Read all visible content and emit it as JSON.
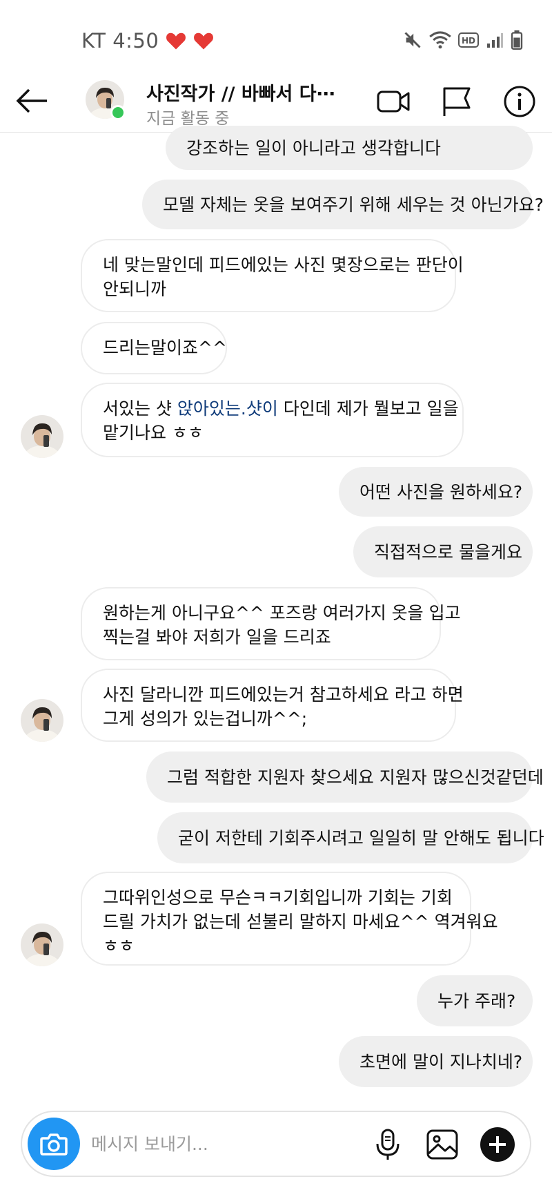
{
  "status_bar": {
    "carrier_time": "KT 4:50",
    "heart_color": "#e53935"
  },
  "header": {
    "title": "사진작가 // 바빠서 다⋯",
    "subtitle": "지금 활동 중",
    "online_color": "#36c759"
  },
  "messages": [
    {
      "side": "out",
      "lines": [
        "강조하는 일이 아니라고 생각합니다"
      ]
    },
    {
      "side": "out",
      "lines": [
        "모델 자체는 옷을 보여주기 위해 세우는 것 아닌가요?"
      ]
    },
    {
      "side": "in",
      "lines": [
        "네 맞는말인데 피드에있는 사진 몇장으로는 판단이",
        "안되니까"
      ]
    },
    {
      "side": "in",
      "lines": [
        "드리는말이죠^^"
      ]
    },
    {
      "side": "in",
      "lines_parts": [
        [
          "서있는 샷 ",
          "앉아있는.샷이",
          " 다인데 제가 뭘보고 일을"
        ],
        [
          "맡기나요 ㅎㅎ"
        ]
      ]
    },
    {
      "side": "out",
      "lines": [
        "어떤 사진을 원하세요?"
      ]
    },
    {
      "side": "out",
      "lines": [
        "직접적으로 물을게요"
      ]
    },
    {
      "side": "in",
      "lines": [
        "원하는게 아니구요^^ 포즈랑 여러가지 옷을 입고",
        "찍는걸 봐야 저희가 일을 드리죠"
      ]
    },
    {
      "side": "in",
      "lines": [
        "사진 달라니깐 피드에있는거 참고하세요 라고 하면",
        "그게 성의가 있는겁니까^^;"
      ]
    },
    {
      "side": "out",
      "lines": [
        "그럼 적합한 지원자 찾으세요 지원자 많으신것같던데"
      ]
    },
    {
      "side": "out",
      "lines": [
        "굳이 저한테 기회주시려고 일일히 말 안해도 됩니다"
      ]
    },
    {
      "side": "in",
      "lines": [
        "그따위인성으로 무슨ㅋㅋ기회입니까 기회는 기회",
        "드릴 가치가 없는데 섣불리 말하지 마세요^^ 역겨워요",
        "ㅎㅎ"
      ]
    },
    {
      "side": "out",
      "lines": [
        "누가 주래?"
      ]
    },
    {
      "side": "out",
      "lines": [
        "초면에 말이 지나치네?"
      ]
    }
  ],
  "composer": {
    "placeholder": "메시지 보내기...",
    "camera_color": "#2196f3"
  },
  "icons": [
    "back-arrow-icon",
    "video-call-icon",
    "flag-icon",
    "info-icon",
    "camera-icon",
    "microphone-icon",
    "gallery-icon",
    "plus-icon",
    "mute-icon",
    "wifi-icon",
    "hd-icon",
    "signal-icon",
    "battery-icon"
  ]
}
